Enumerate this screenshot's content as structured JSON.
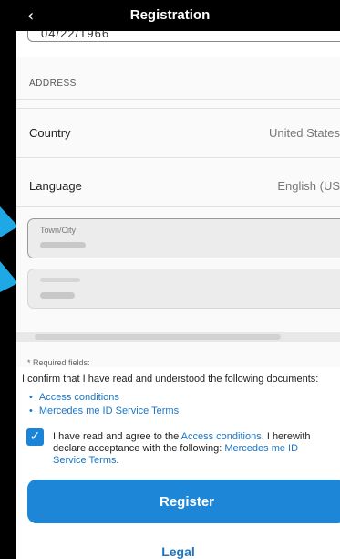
{
  "nav": {
    "back_icon": "chevron-left-icon",
    "back_glyph": "‹",
    "title": "Registration"
  },
  "form": {
    "date_value": "04/22/1966",
    "section_header": "ADDRESS",
    "country": {
      "label": "Country",
      "value": "United States"
    },
    "language": {
      "label": "Language",
      "value": "English (US"
    },
    "town": {
      "label": "Town/City"
    },
    "zip": {
      "label": ""
    }
  },
  "footer": {
    "required_note": "* Required fields:",
    "confirm_text": "I confirm that I have read and understood the following documents:",
    "documents": [
      {
        "label": "Access conditions"
      },
      {
        "label": "Mercedes me ID Service Terms"
      }
    ],
    "agree": {
      "checked": true,
      "check_icon": "checkmark-icon",
      "check_glyph": "✓",
      "text_before": "I have read and agree to the ",
      "link1": "Access conditions",
      "text_middle": ". I herewith declare acceptance with the following: ",
      "link2": "Mercedes me ID Service Terms",
      "text_after": "."
    },
    "register_label": "Register",
    "legal_label": "Legal"
  },
  "colors": {
    "accent": "#1e86d6",
    "link": "#1a76c5",
    "annotation_arrow": "#1ea8e6"
  }
}
